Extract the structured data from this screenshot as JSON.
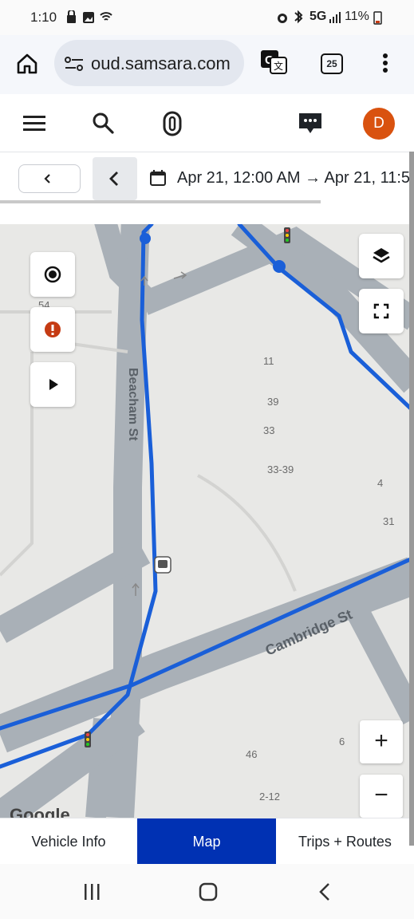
{
  "status_bar": {
    "time": "1:10",
    "network": "5G",
    "battery": "11%"
  },
  "browser": {
    "url": "oud.samsara.com",
    "tab_count": "25"
  },
  "header": {
    "avatar_initial": "D"
  },
  "date_range": {
    "text": "Apr 21, 12:00 AM → Apr 21, 11:5"
  },
  "map": {
    "streets": [
      "Beacham St",
      "Cambridge St"
    ],
    "addresses": [
      "54",
      "11",
      "39",
      "33",
      "33-39",
      "4",
      "31",
      "6",
      "46",
      "2-12"
    ],
    "zoom_in": "+",
    "zoom_out": "−",
    "route_color": "#1a5fd8"
  },
  "tabs": [
    {
      "label": "Vehicle Info",
      "active": false
    },
    {
      "label": "Map",
      "active": true
    },
    {
      "label": "Trips + Routes",
      "active": false
    }
  ],
  "colors": {
    "accent": "#0031b3",
    "avatar": "#d9520f",
    "alert": "#c53b13"
  }
}
